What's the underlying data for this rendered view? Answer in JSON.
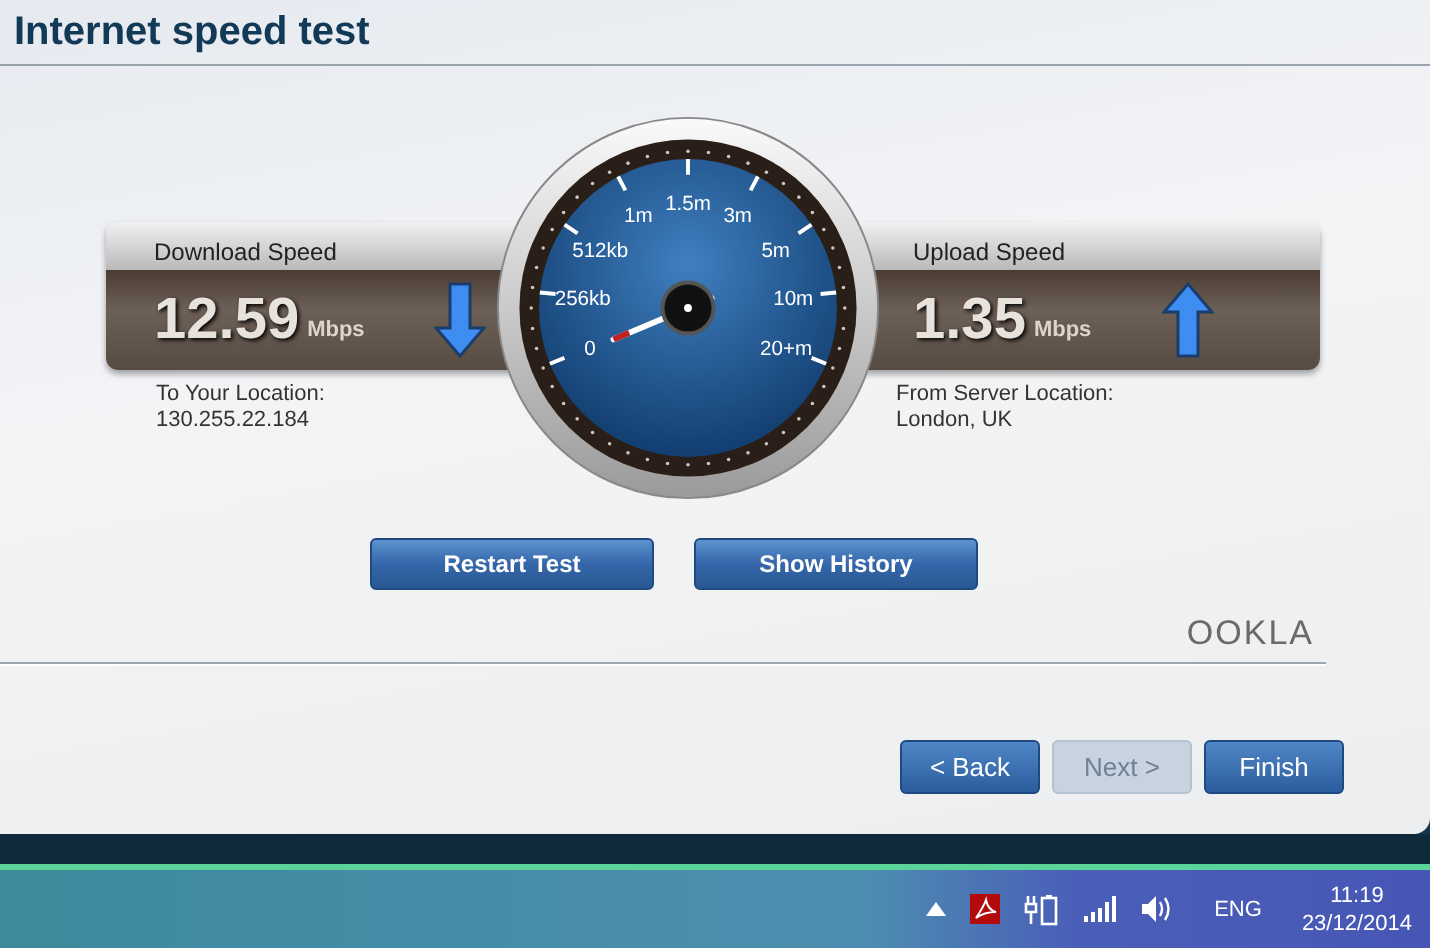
{
  "window": {
    "title": "Internet speed test"
  },
  "download": {
    "label": "Download Speed",
    "value": "12.59",
    "unit": "Mbps",
    "caption": "To Your Location:",
    "detail": "130.255.22.184"
  },
  "upload": {
    "label": "Upload Speed",
    "value": "1.35",
    "unit": "Mbps",
    "caption": "From Server Location:",
    "detail": "London, UK"
  },
  "gauge": {
    "scale_labels": [
      "0",
      "256kb",
      "512kb",
      "1m",
      "1.5m",
      "3m",
      "5m",
      "10m",
      "20+m"
    ]
  },
  "actions": [
    {
      "label": "Restart Test"
    },
    {
      "label": "Show History"
    }
  ],
  "logo": {
    "text": "OOKLA"
  },
  "nav_buttons": [
    {
      "label": "< Back",
      "disabled": false
    },
    {
      "label": "Next >",
      "disabled": true
    },
    {
      "label": "Finish",
      "disabled": false
    }
  ],
  "taskbar": {
    "language": "ENG",
    "time": "11:19",
    "date": "23/12/2014"
  }
}
